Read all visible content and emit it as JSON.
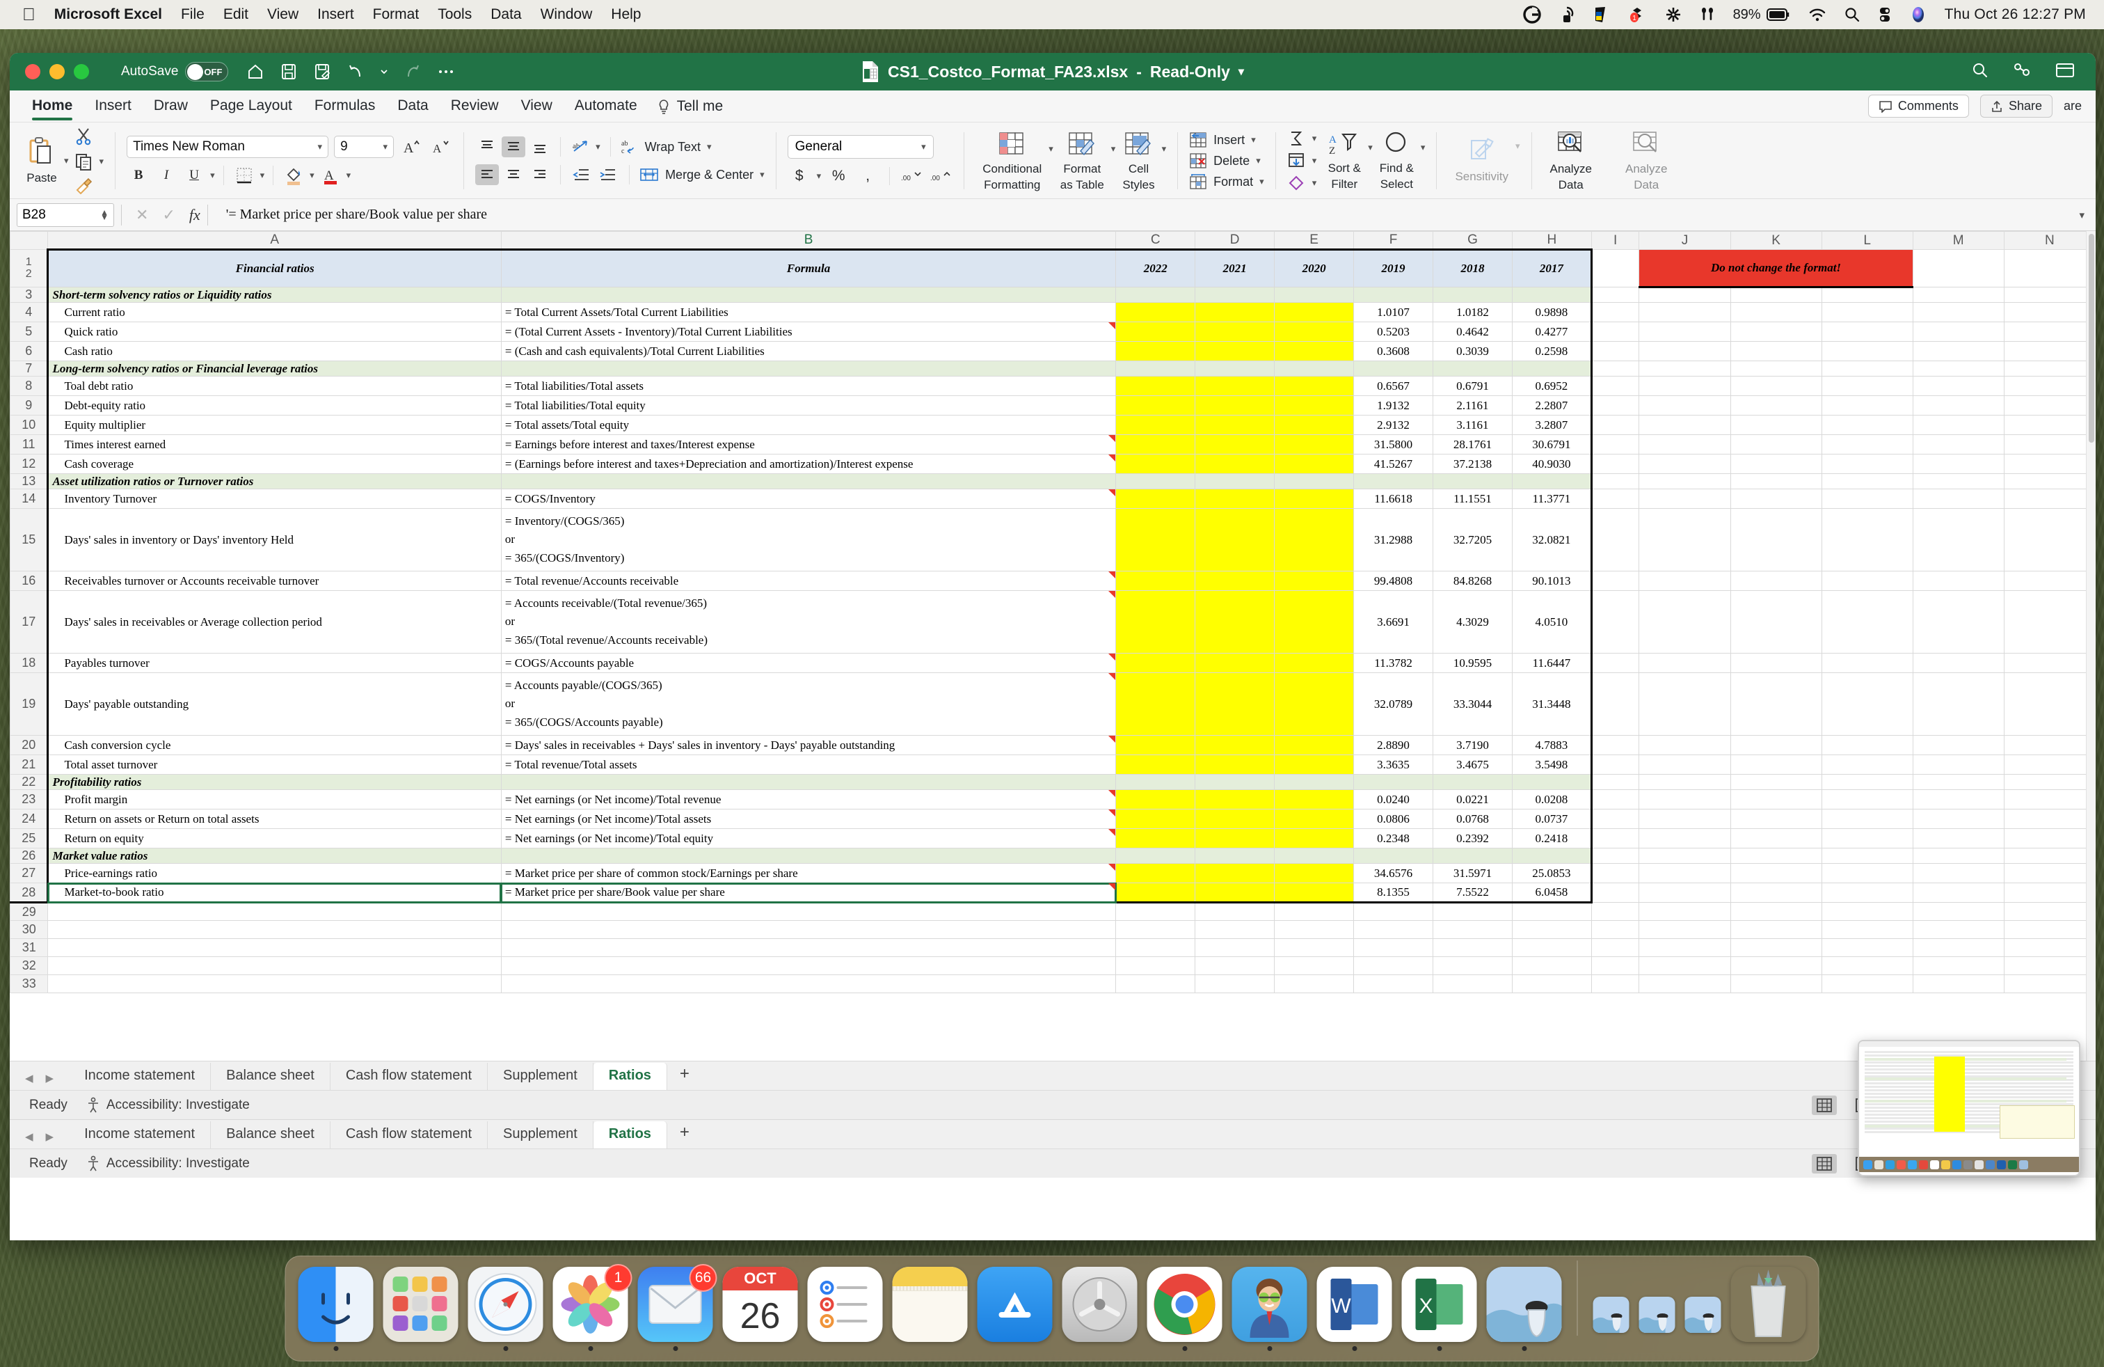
{
  "menubar": {
    "apple": "apple-logo",
    "app_name": "Microsoft Excel",
    "items": [
      "File",
      "Edit",
      "View",
      "Insert",
      "Format",
      "Tools",
      "Data",
      "Window",
      "Help"
    ],
    "status_icons": [
      "grammarly-icon",
      "airdrop-icon",
      "ukraine-flag-icon",
      "dropbox-icon",
      "asterisk-icon",
      "airpods-icon",
      "battery-icon",
      "wifi-icon",
      "spotlight-icon",
      "control-center-icon",
      "siri-icon"
    ],
    "battery": "89%",
    "clock": "Thu Oct 26  12:27 PM"
  },
  "titlebar": {
    "autosave_label": "AutoSave",
    "autosave_state": "OFF",
    "quick_access": [
      "home-icon",
      "save-icon",
      "save-as-icon",
      "undo-icon",
      "undo-caret-icon",
      "redo-icon",
      "more-icon"
    ],
    "filename": "CS1_Costco_Format_FA23.xlsx",
    "separator": "-",
    "readonly": "Read-Only",
    "right_icons": [
      "search-icon",
      "collaborate-icon",
      "ribbon-display-icon"
    ]
  },
  "ribbon": {
    "tabs": [
      "Home",
      "Insert",
      "Draw",
      "Page Layout",
      "Formulas",
      "Data",
      "Review",
      "View",
      "Automate"
    ],
    "active_tab": "Home",
    "tellme": "Tell me",
    "comments": "Comments",
    "share": "Share",
    "share_cut": "are",
    "clipboard": {
      "paste": "Paste",
      "cut": "cut-icon",
      "copy": "copy-icon",
      "format_painter": "format-painter-icon"
    },
    "font": {
      "family": "Times New Roman",
      "size": "9",
      "grow": "A^",
      "shrink": "Av",
      "bold": "B",
      "italic": "I",
      "underline": "U",
      "borders": "borders-icon",
      "fill": "fill-color-icon",
      "fontcolor": "font-color-icon"
    },
    "alignment": {
      "top": "align-top-icon",
      "middle": "align-middle-icon",
      "bottom": "align-bottom-icon",
      "left": "align-left-icon",
      "center": "align-center-icon",
      "right": "align-right-icon",
      "orientation": "text-orientation-icon",
      "decrease_indent": "decrease-indent-icon",
      "increase_indent": "increase-indent-icon",
      "wrap": "Wrap Text",
      "merge": "Merge & Center"
    },
    "number": {
      "format": "General",
      "currency": "$",
      "percent": "%",
      "comma": ",",
      "increase_decimal": ".00",
      "decrease_decimal": ".0"
    },
    "styles": {
      "conditional": "Conditional\nFormatting",
      "conditional_l1": "Conditional",
      "conditional_l2": "Formatting",
      "table_l1": "Format",
      "table_l2": "as Table",
      "cell_l1": "Cell",
      "cell_l2": "Styles"
    },
    "cells": {
      "insert": "Insert",
      "delete": "Delete",
      "format": "Format"
    },
    "editing": {
      "autosum": "autosum-icon",
      "fill": "fill-down-icon",
      "clear": "clear-icon",
      "sort_l1": "Sort &",
      "sort_l2": "Filter",
      "find_l1": "Find &",
      "find_l2": "Select"
    },
    "sensitivity": "Sensitivity",
    "analyze_l1": "Analyze",
    "analyze_l2": "Data"
  },
  "formulabar": {
    "namebox": "B28",
    "cancel": "cancel-icon",
    "enter": "enter-icon",
    "fx": "fx",
    "content": "'= Market price per share/Book value per share"
  },
  "grid": {
    "columns": [
      "A",
      "B",
      "C",
      "D",
      "E",
      "F",
      "G",
      "H",
      "I",
      "J",
      "K",
      "L",
      "M",
      "N"
    ],
    "active_column": "B",
    "banner": "Do not change the format!",
    "headers": {
      "a": "Financial ratios",
      "b": "Formula",
      "years": [
        "2022",
        "2021",
        "2020",
        "2019",
        "2018",
        "2017"
      ]
    },
    "rows": [
      {
        "n": "3",
        "type": "section",
        "label": "Short-term solvency ratios or Liquidity ratios"
      },
      {
        "n": "4",
        "type": "data",
        "label": "Current ratio",
        "formula": "= Total Current Assets/Total Current Liabilities",
        "values": [
          "1.0107",
          "1.0182",
          "0.9898"
        ],
        "comment": false
      },
      {
        "n": "5",
        "type": "data",
        "label": "Quick ratio",
        "formula": "= (Total Current Assets - Inventory)/Total Current Liabilities",
        "values": [
          "0.5203",
          "0.4642",
          "0.4277"
        ],
        "comment": true
      },
      {
        "n": "6",
        "type": "data",
        "label": "Cash ratio",
        "formula": "= (Cash and cash equivalents)/Total Current Liabilities",
        "values": [
          "0.3608",
          "0.3039",
          "0.2598"
        ],
        "comment": false
      },
      {
        "n": "7",
        "type": "section",
        "label": "Long-term solvency ratios or Financial leverage ratios"
      },
      {
        "n": "8",
        "type": "data",
        "label": "Toal debt ratio",
        "formula": "= Total liabilities/Total assets",
        "values": [
          "0.6567",
          "0.6791",
          "0.6952"
        ],
        "comment": false
      },
      {
        "n": "9",
        "type": "data",
        "label": "Debt-equity ratio",
        "formula": "= Total liabilities/Total equity",
        "values": [
          "1.9132",
          "2.1161",
          "2.2807"
        ],
        "comment": false
      },
      {
        "n": "10",
        "type": "data",
        "label": "Equity multiplier",
        "formula": "= Total assets/Total equity",
        "values": [
          "2.9132",
          "3.1161",
          "3.2807"
        ],
        "comment": false
      },
      {
        "n": "11",
        "type": "data",
        "label": "Times interest earned",
        "formula": "= Earnings before interest and taxes/Interest expense",
        "values": [
          "31.5800",
          "28.1761",
          "30.6791"
        ],
        "comment": true
      },
      {
        "n": "12",
        "type": "data",
        "label": "Cash coverage",
        "formula": "= (Earnings before interest and taxes+Depreciation and amortization)/Interest expense",
        "values": [
          "41.5267",
          "37.2138",
          "40.9030"
        ],
        "comment": true
      },
      {
        "n": "13",
        "type": "section",
        "label": "Asset utilization ratios or Turnover ratios"
      },
      {
        "n": "14",
        "type": "data",
        "label": "Inventory Turnover",
        "formula": "= COGS/Inventory",
        "values": [
          "11.6618",
          "11.1551",
          "11.3771"
        ],
        "comment": true
      },
      {
        "n": "15",
        "type": "tall",
        "label": "Days' sales in inventory or Days' inventory Held",
        "formula_lines": [
          "= Inventory/(COGS/365)",
          "or",
          "= 365/(COGS/Inventory)"
        ],
        "values": [
          "31.2988",
          "32.7205",
          "32.0821"
        ],
        "comment": false
      },
      {
        "n": "16",
        "type": "data",
        "label": "Receivables turnover or Accounts receivable turnover",
        "formula": "= Total revenue/Accounts receivable",
        "values": [
          "99.4808",
          "84.8268",
          "90.1013"
        ],
        "comment": true
      },
      {
        "n": "17",
        "type": "tall",
        "label": "Days' sales in receivables or Average collection period",
        "formula_lines": [
          "= Accounts receivable/(Total revenue/365)",
          "or",
          "= 365/(Total revenue/Accounts receivable)"
        ],
        "values": [
          "3.6691",
          "4.3029",
          "4.0510"
        ],
        "comment": true
      },
      {
        "n": "18",
        "type": "data",
        "label": "Payables turnover",
        "formula": "= COGS/Accounts payable",
        "values": [
          "11.3782",
          "10.9595",
          "11.6447"
        ],
        "comment": true
      },
      {
        "n": "19",
        "type": "tall",
        "label": "Days' payable outstanding",
        "formula_lines": [
          "= Accounts payable/(COGS/365)",
          "or",
          "= 365/(COGS/Accounts payable)"
        ],
        "values": [
          "32.0789",
          "33.3044",
          "31.3448"
        ],
        "comment": true
      },
      {
        "n": "20",
        "type": "data",
        "label": "Cash conversion cycle",
        "formula": "= Days' sales in receivables + Days' sales in inventory - Days' payable outstanding",
        "values": [
          "2.8890",
          "3.7190",
          "4.7883"
        ],
        "comment": true
      },
      {
        "n": "21",
        "type": "data",
        "label": "Total asset turnover",
        "formula": "= Total revenue/Total assets",
        "values": [
          "3.3635",
          "3.4675",
          "3.5498"
        ],
        "comment": false
      },
      {
        "n": "22",
        "type": "section",
        "label": "Profitability ratios"
      },
      {
        "n": "23",
        "type": "data",
        "label": "Profit margin",
        "formula": "= Net earnings (or Net income)/Total revenue",
        "values": [
          "0.0240",
          "0.0221",
          "0.0208"
        ],
        "comment": true
      },
      {
        "n": "24",
        "type": "data",
        "label": "Return on assets or Return on total assets",
        "formula": "= Net earnings (or Net income)/Total assets",
        "values": [
          "0.0806",
          "0.0768",
          "0.0737"
        ],
        "comment": true
      },
      {
        "n": "25",
        "type": "data",
        "label": "Return on equity",
        "formula": "= Net earnings (or Net income)/Total equity",
        "values": [
          "0.2348",
          "0.2392",
          "0.2418"
        ],
        "comment": true
      },
      {
        "n": "26",
        "type": "section",
        "label": "Market value ratios"
      },
      {
        "n": "27",
        "type": "data",
        "label": "Price-earnings ratio",
        "formula": "= Market price per share of common stock/Earnings per share",
        "values": [
          "34.6576",
          "31.5971",
          "25.0853"
        ],
        "comment": true
      },
      {
        "n": "28",
        "type": "data",
        "label": "Market-to-book ratio",
        "formula": "= Market price per share/Book value per share",
        "values": [
          "8.1355",
          "7.5522",
          "6.0458"
        ],
        "comment": true,
        "selected": true
      }
    ],
    "empty_rows": [
      "29",
      "30",
      "31",
      "32",
      "33"
    ]
  },
  "sheets": {
    "tabs": [
      "Income statement",
      "Balance sheet",
      "Cash flow statement",
      "Supplement",
      "Ratios"
    ],
    "active": "Ratios",
    "add": "+"
  },
  "status": {
    "ready": "Ready",
    "accessibility": "Accessibility: Investigate",
    "views": [
      "normal-view-icon",
      "page-layout-icon",
      "page-break-icon"
    ],
    "zoom_out": "-",
    "zoom_in": "+"
  },
  "dock": {
    "items": [
      {
        "name": "finder",
        "badge": ""
      },
      {
        "name": "launchpad",
        "badge": ""
      },
      {
        "name": "safari",
        "badge": ""
      },
      {
        "name": "photos",
        "badge": "1"
      },
      {
        "name": "mail",
        "badge": "66"
      },
      {
        "name": "calendar",
        "badge": "",
        "month": "OCT",
        "day": "26"
      },
      {
        "name": "reminders",
        "badge": ""
      },
      {
        "name": "notes",
        "badge": ""
      },
      {
        "name": "app-store",
        "badge": ""
      },
      {
        "name": "system-preferences",
        "badge": ""
      },
      {
        "name": "google-chrome",
        "badge": ""
      },
      {
        "name": "zoom",
        "badge": ""
      },
      {
        "name": "microsoft-word",
        "badge": ""
      },
      {
        "name": "microsoft-excel",
        "badge": ""
      },
      {
        "name": "preview",
        "badge": ""
      }
    ],
    "minimized": [
      "window-1",
      "window-2",
      "window-3"
    ],
    "trash": "trash"
  },
  "colors": {
    "excel_green": "#217346",
    "header_blue": "#dbe5f1",
    "section_green": "#e4eedb",
    "highlight_yellow": "#ffff00",
    "banner_red": "#e8372b"
  }
}
